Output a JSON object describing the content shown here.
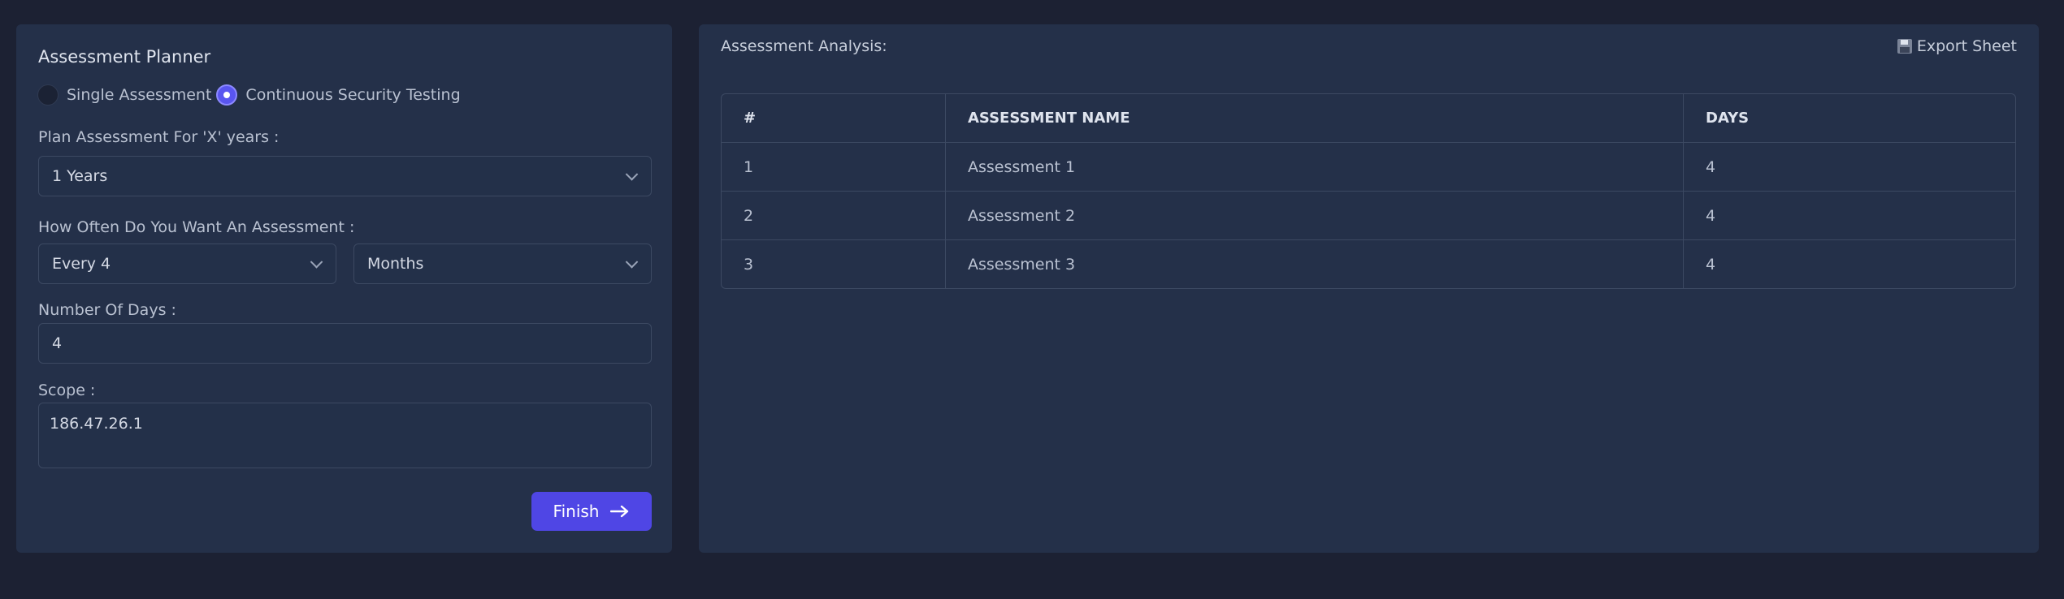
{
  "planner": {
    "title": "Assessment Planner",
    "radio_single": "Single Assessment",
    "radio_continuous": "Continuous Security Testing",
    "selected_mode": "Continuous Security Testing",
    "years_label": "Plan Assessment For 'X' years :",
    "years_value": "1 Years",
    "frequency_label": "How Often Do You Want An Assessment :",
    "frequency_value": "Every 4",
    "frequency_unit": "Months",
    "days_label": "Number Of Days :",
    "days_value": "4",
    "scope_label": "Scope :",
    "scope_value": "186.47.26.1",
    "finish_label": "Finish"
  },
  "analysis": {
    "title": "Assessment Analysis:",
    "export_label": "Export Sheet",
    "columns": [
      "#",
      "ASSESSMENT NAME",
      "DAYS"
    ],
    "rows": [
      [
        "1",
        "Assessment 1",
        "4"
      ],
      [
        "2",
        "Assessment 2",
        "4"
      ],
      [
        "3",
        "Assessment 3",
        "4"
      ]
    ]
  },
  "colors": {
    "background": "#1c2133",
    "panel": "#243049",
    "accent": "#4f46e5"
  },
  "icons": [
    "chevron-down-icon",
    "arrow-right-icon",
    "floppy-disk-icon"
  ]
}
